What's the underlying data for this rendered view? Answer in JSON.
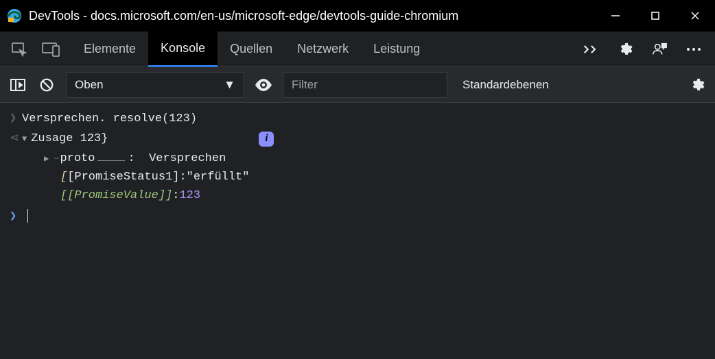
{
  "titlebar": {
    "title": "DevTools - docs.microsoft.com/en-us/microsoft-edge/devtools-guide-chromium"
  },
  "tabs": {
    "elements": "Elemente",
    "console": "Konsole",
    "sources": "Quellen",
    "network": "Netzwerk",
    "performance": "Leistung"
  },
  "toolbar": {
    "context": "Oben",
    "filter_placeholder": "Filter",
    "levels": "Standardebenen"
  },
  "console": {
    "input_line": "Versprechen. resolve(123)",
    "result_header": "Zusage 123}",
    "info_badge": "i",
    "proto_label": "proto",
    "proto_colon": ":",
    "proto_value": "Versprechen",
    "status_key": "[PromiseStatus1]",
    "status_sep": ": ",
    "status_val": "\"erfüllt\"",
    "value_key": "[[PromiseValue]]",
    "value_sep": ": ",
    "value_val": "123"
  }
}
